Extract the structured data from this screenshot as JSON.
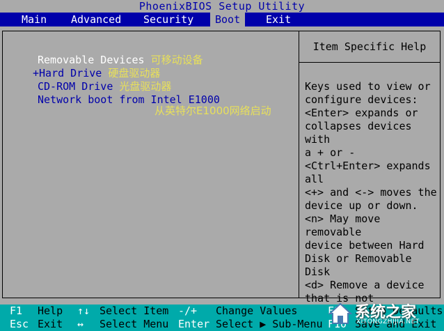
{
  "title": "PhoenixBIOS Setup Utility",
  "menu": {
    "tabs": [
      "Main",
      "Advanced",
      "Security",
      "Boot",
      "Exit"
    ],
    "active": "Boot"
  },
  "boot_items": [
    {
      "prefix": "",
      "label": "Removable Devices",
      "note": "可移动设备",
      "selected": true
    },
    {
      "prefix": "+",
      "label": "Hard Drive",
      "note": "硬盘驱动器",
      "selected": false
    },
    {
      "prefix": "",
      "label": "CD-ROM Drive",
      "note": "光盘驱动器",
      "selected": false
    },
    {
      "prefix": "",
      "label": "Network boot from Intel E1000",
      "note": "",
      "selected": false
    }
  ],
  "network_note": "从英特尔E1000网络启动",
  "help": {
    "title": "Item Specific Help",
    "body": "Keys used to view or\nconfigure devices:\n<Enter> expands or\ncollapses devices with\na + or -\n<Ctrl+Enter> expands\nall\n<+> and <-> moves the\ndevice up or down.\n<n> May move removable\ndevice between Hard\nDisk or Removable Disk\n<d> Remove a device\nthat is not installed."
  },
  "status": {
    "row1": [
      {
        "key": "F1",
        "desc": "Help"
      },
      {
        "key": "↑↓",
        "desc": "Select Item"
      },
      {
        "key": "-/+",
        "desc": "Change Values"
      },
      {
        "key": "F9",
        "desc": "Setup Defaults"
      }
    ],
    "row2": [
      {
        "key": "Esc",
        "desc": "Exit"
      },
      {
        "key": "↔",
        "desc": "Select Menu"
      },
      {
        "key": "Enter",
        "desc": "Select ▶ Sub-Menu"
      },
      {
        "key": "F10",
        "desc": "Save and Exit"
      }
    ]
  },
  "watermark": {
    "text": "系统之家",
    "url": "XITONGZHIJIA.NET"
  },
  "colors": {
    "bios_blue": "#0000aa",
    "bios_gray": "#aaaaaa",
    "bios_cyan": "#00aaaa",
    "note_yellow": "#e8e05a"
  }
}
